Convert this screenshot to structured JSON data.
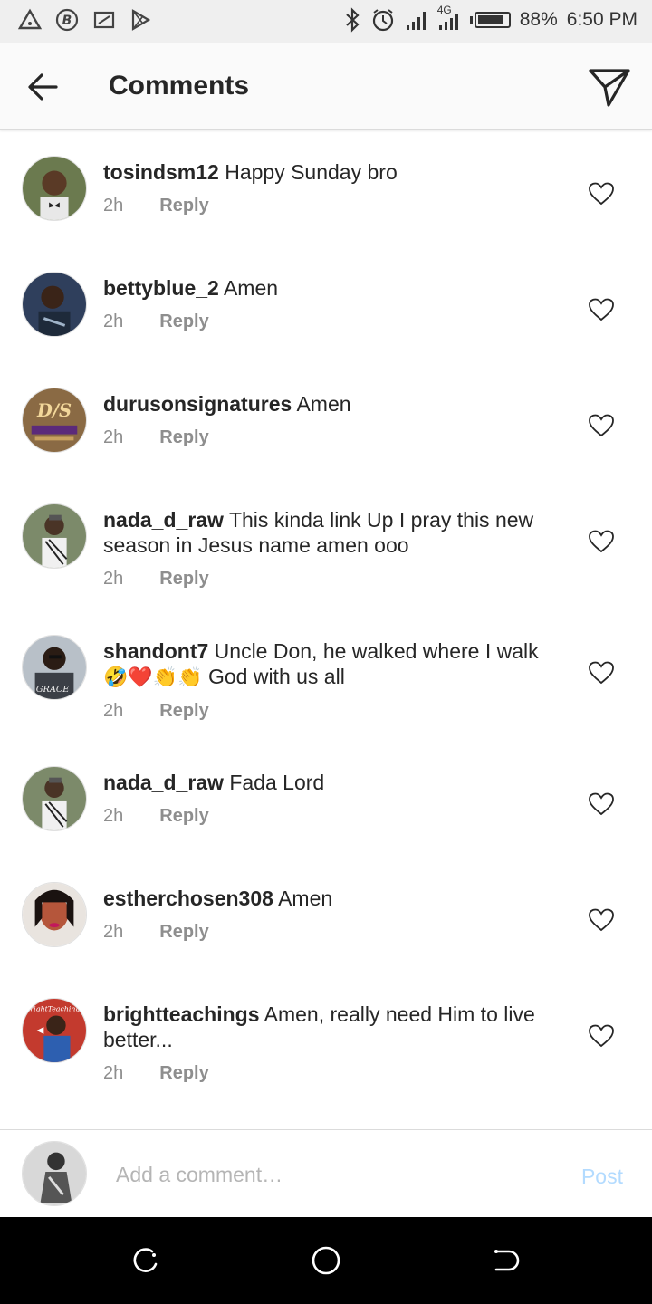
{
  "status_bar": {
    "network": "4G",
    "battery": "88%",
    "time": "6:50 PM"
  },
  "header": {
    "title": "Comments"
  },
  "comments": [
    {
      "user": "tosindsm12",
      "text": "Happy Sunday bro",
      "time": "2h",
      "reply": "Reply",
      "avatar_color": "#6b7a4f"
    },
    {
      "user": "bettyblue_2",
      "text": "Amen",
      "time": "2h",
      "reply": "Reply",
      "avatar_color": "#2f3f5c"
    },
    {
      "user": "durusonsignatures",
      "text": "Amen",
      "time": "2h",
      "reply": "Reply",
      "avatar_color": "#8a6a44"
    },
    {
      "user": "nada_d_raw",
      "text": "This kinda link Up I pray this new season in Jesus name amen ooo",
      "time": "2h",
      "reply": "Reply",
      "avatar_color": "#7c8a6a"
    },
    {
      "user": "shandont7",
      "text": "Uncle Don, he walked where I walk",
      "emojis": "🤣❤️👏👏",
      "text2": "God with us all",
      "time": "2h",
      "reply": "Reply",
      "avatar_color": "#4a5563"
    },
    {
      "user": "nada_d_raw",
      "text": "Fada Lord",
      "time": "2h",
      "reply": "Reply",
      "avatar_color": "#7c8a6a"
    },
    {
      "user": "estherchosen308",
      "text": "Amen",
      "time": "2h",
      "reply": "Reply",
      "avatar_color": "#b5563b"
    },
    {
      "user": "brightteachings",
      "text": "Amen, really need Him to live better...",
      "time": "2h",
      "reply": "Reply",
      "avatar_color": "#c33a2e"
    }
  ],
  "composer": {
    "placeholder": "Add a comment…",
    "post_label": "Post"
  },
  "colors": {
    "accent_disabled": "#b3dbff",
    "meta_grey": "#8e8e8e"
  }
}
